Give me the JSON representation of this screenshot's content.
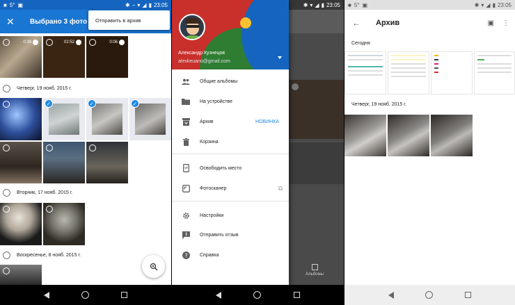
{
  "status": {
    "temp": "5°",
    "time": "23:05"
  },
  "panel1": {
    "title": "Выбрано 3 фото",
    "menu_item": "Отправить в архив",
    "dates": [
      "Четверг, 19 нояб. 2015 г.",
      "Вторник, 17 нояб. 2015 г.",
      "Воскресенье, 8 нояб. 2015 г."
    ],
    "durations": [
      "0:39",
      "02:52",
      "0:06"
    ]
  },
  "panel2": {
    "user_name": "Александр Кузнецов",
    "user_email": "alexkeuano@gmail.com",
    "menu": [
      {
        "label": "Общие альбомы",
        "icon": "people-icon"
      },
      {
        "label": "На устройстве",
        "icon": "folder-icon"
      },
      {
        "label": "Архив",
        "icon": "archive-icon",
        "badge": "НОВИНКА"
      },
      {
        "label": "Корзина",
        "icon": "trash-icon"
      },
      {
        "label": "Освободить место",
        "icon": "phone-icon"
      },
      {
        "label": "Фотосканер",
        "icon": "scanner-icon"
      },
      {
        "label": "Настройки",
        "icon": "gear-icon"
      },
      {
        "label": "Отправить отзыв",
        "icon": "feedback-icon"
      },
      {
        "label": "Справка",
        "icon": "help-icon"
      }
    ],
    "albums_label": "Альбомы"
  },
  "panel3": {
    "title": "Архив",
    "sections": [
      "Сегодня",
      "Четверг, 19 нояб. 2015 г."
    ]
  }
}
